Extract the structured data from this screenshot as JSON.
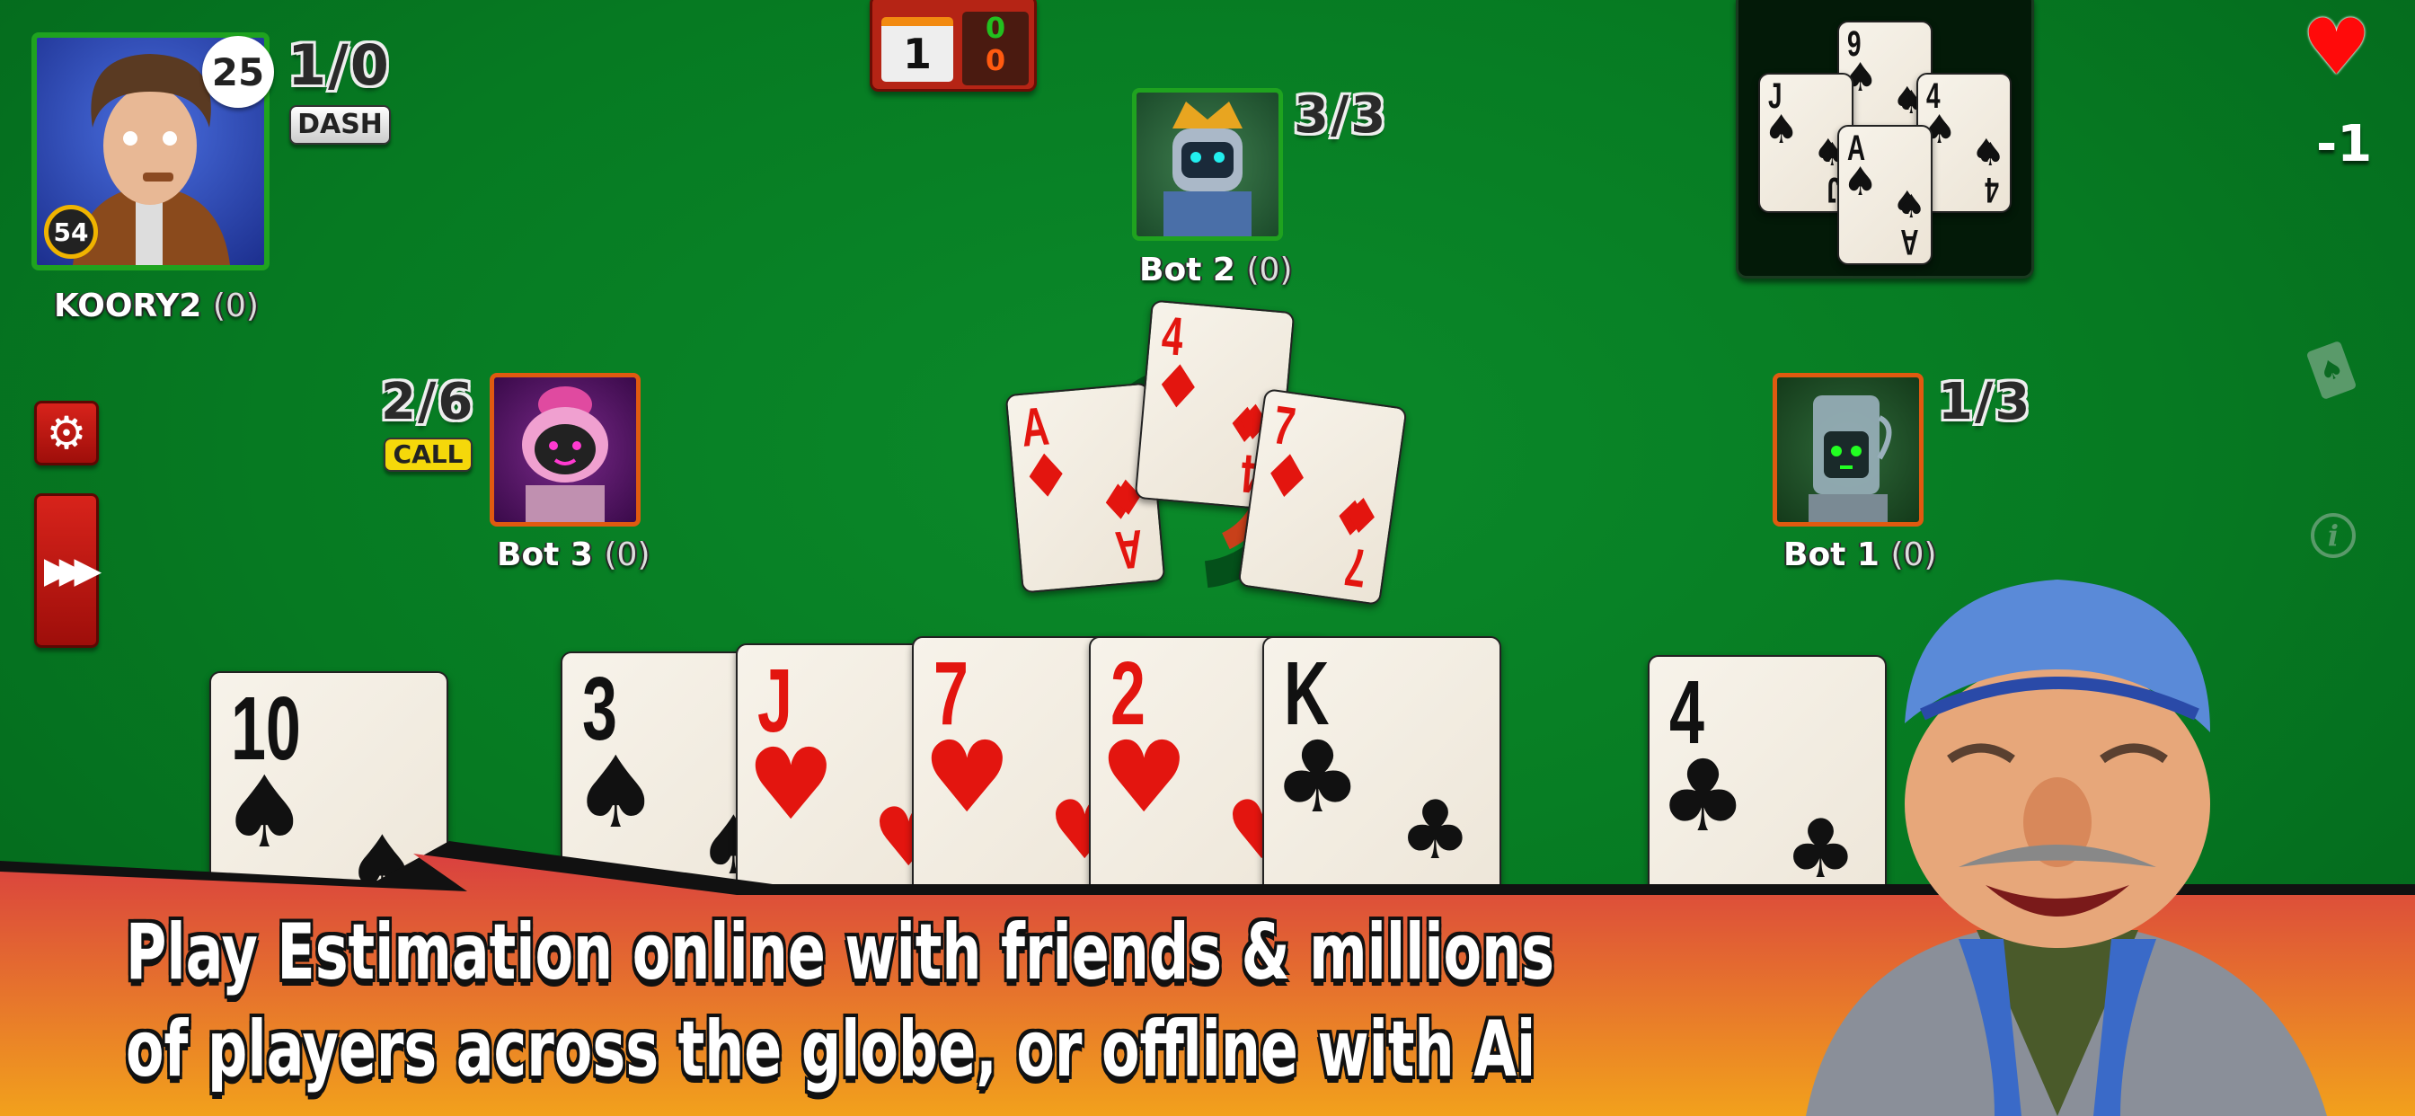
{
  "player": {
    "name": "KOORY2",
    "points": "(0)",
    "score": "1/0",
    "bid_badge": "DASH",
    "bubble": "25",
    "level": "54",
    "frame_color": "#1fa31f"
  },
  "bot2": {
    "name": "Bot 2",
    "points": "(0)",
    "score": "3/3",
    "frame_color": "#1fa31f"
  },
  "bot3": {
    "name": "Bot 3",
    "points": "(0)",
    "score": "2/6",
    "bid_badge": "CALL",
    "frame_color": "#e05a10"
  },
  "bot1": {
    "name": "Bot 1",
    "points": "(0)",
    "score": "1/3",
    "frame_color": "#e05a10"
  },
  "round_box": {
    "round": "1",
    "team_score_a": "0",
    "team_score_b": "0",
    "color_a": "#22c01f",
    "color_b": "#ff5a10"
  },
  "trump": {
    "suit_icon": "heart-icon",
    "value": "-1",
    "color": "#ff0a0a"
  },
  "last_trick": [
    {
      "rank": "9",
      "suit": "♠"
    },
    {
      "rank": "J",
      "suit": "♠"
    },
    {
      "rank": "4",
      "suit": "♠"
    },
    {
      "rank": "A",
      "suit": "♠"
    }
  ],
  "table_trick": [
    {
      "rank": "A",
      "suit": "♦"
    },
    {
      "rank": "4",
      "suit": "♦"
    },
    {
      "rank": "7",
      "suit": "♦"
    }
  ],
  "hand": [
    {
      "rank": "10",
      "suit": "♠"
    },
    {
      "rank": "3",
      "suit": "♠"
    },
    {
      "rank": "J",
      "suit": "♥"
    },
    {
      "rank": "7",
      "suit": "♥"
    },
    {
      "rank": "2",
      "suit": "♥"
    },
    {
      "rank": "K",
      "suit": "♣"
    },
    {
      "rank": "4",
      "suit": "♣"
    }
  ],
  "controls": {
    "settings_icon": "gear-icon",
    "fast_forward_icon": "fast-forward-icon",
    "cards_icon": "card-burst-icon",
    "info_icon": "info-icon"
  },
  "banner": {
    "line1": "Play Estimation online with friends & millions",
    "line2": "of players across the globe, or offline with Ai",
    "gradient_top": "#d9403f",
    "gradient_bottom": "#f2a11c"
  }
}
